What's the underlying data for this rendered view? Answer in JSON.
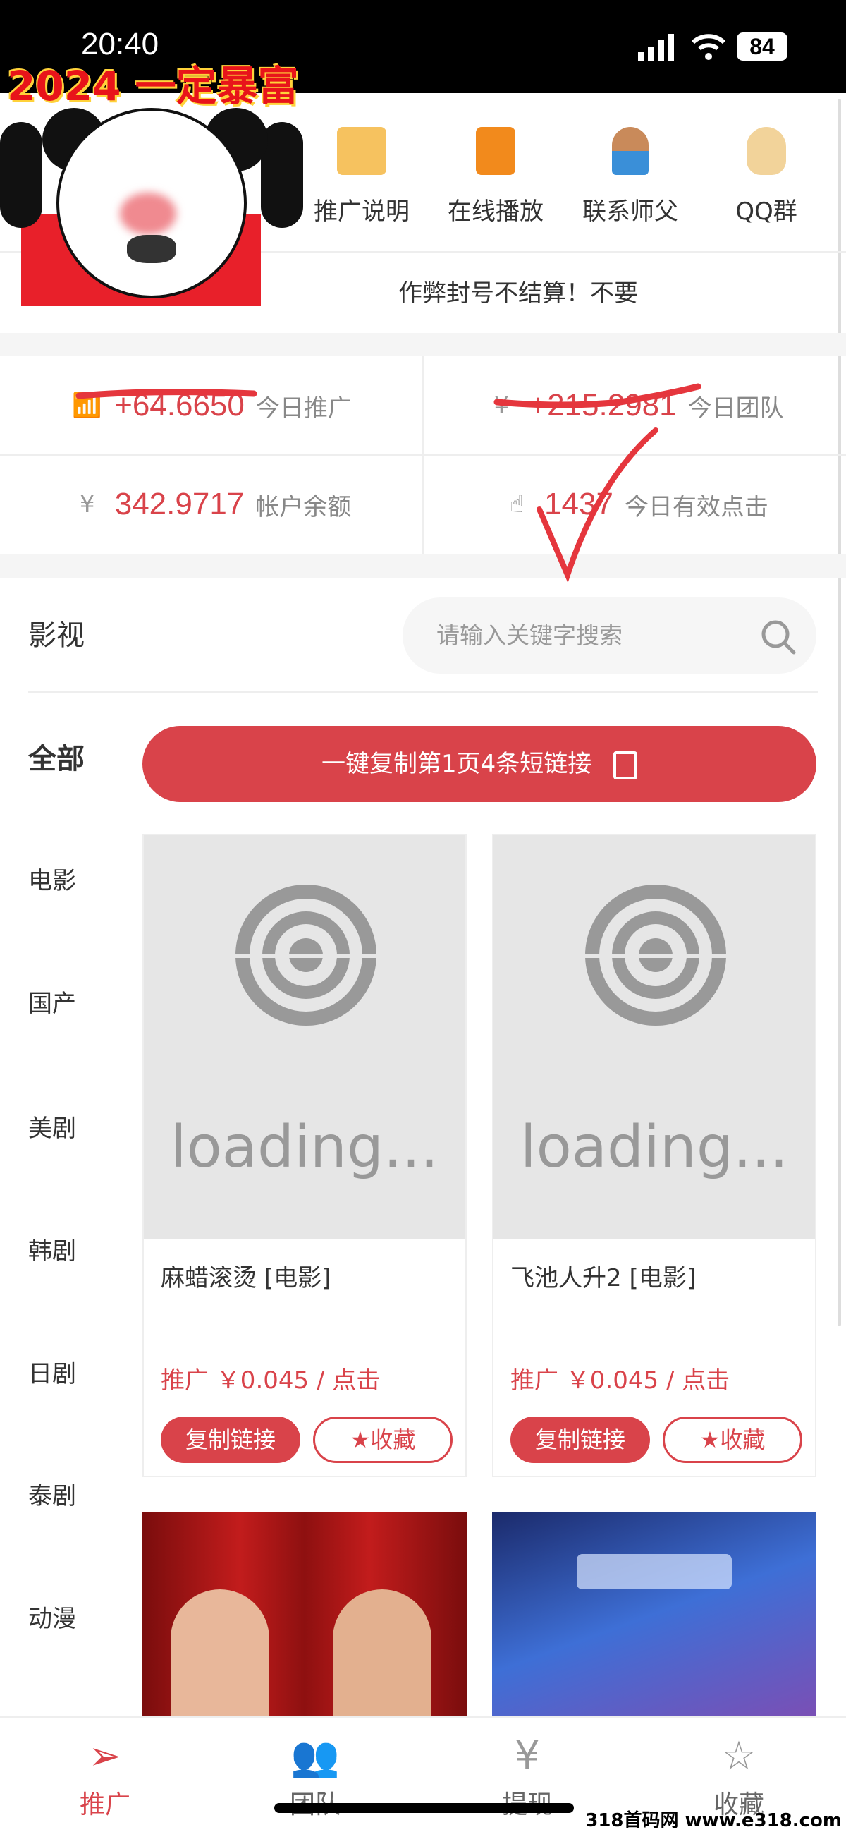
{
  "status_bar": {
    "time": "20:40",
    "battery": "84"
  },
  "overlay": {
    "caption": "2024 一定暴富"
  },
  "quick_links": [
    {
      "label": "推广说明",
      "icon": "folder-icon",
      "color": "#f6c25f"
    },
    {
      "label": "在线播放",
      "icon": "play-video-icon",
      "color": "#f28a1c"
    },
    {
      "label": "联系师父",
      "icon": "customer-service-icon",
      "color": "#3a8fd8"
    },
    {
      "label": "QQ群",
      "icon": "qq-penguin-icon",
      "color": "#f2d39a"
    }
  ],
  "notice": "作弊封号不结算！不要",
  "stats": [
    {
      "value": "+64.6650",
      "label": "今日推广",
      "icon": "chart-icon"
    },
    {
      "value": "+215.2981",
      "label": "今日团队",
      "icon": "shield-yen-icon"
    },
    {
      "value": "342.9717",
      "label": "帐户余额",
      "icon": "wallet-yen-icon"
    },
    {
      "value": "1437",
      "label": "今日有效点击",
      "icon": "tap-icon"
    }
  ],
  "section_title": "影视",
  "search": {
    "placeholder": "请输入关键字搜索"
  },
  "categories": [
    "全部",
    "电影",
    "国产",
    "美剧",
    "韩剧",
    "日剧",
    "泰剧",
    "动漫"
  ],
  "copy_all_button": "一键复制第1页4条短链接",
  "cards": [
    {
      "title": "麻蜡滚烫 [电影]",
      "price": "推广 ￥0.045 / 点击",
      "copy": "复制链接",
      "fav": "收藏",
      "loading": "loading..."
    },
    {
      "title": "飞池人升2 [电影]",
      "price": "推广 ￥0.045 / 点击",
      "copy": "复制链接",
      "fav": "收藏",
      "loading": "loading..."
    }
  ],
  "tabs": [
    {
      "label": "推广",
      "icon": "paper-plane-icon",
      "active": true
    },
    {
      "label": "团队",
      "icon": "team-icon"
    },
    {
      "label": "提现",
      "icon": "withdraw-yen-icon"
    },
    {
      "label": "收藏",
      "icon": "star-icon"
    }
  ],
  "accent_color": "#d9434a",
  "watermark": "318首码网 www.e318.com"
}
